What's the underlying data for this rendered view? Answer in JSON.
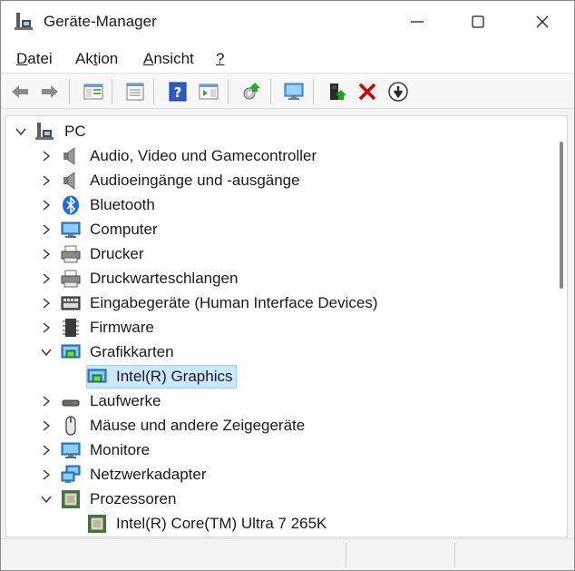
{
  "window": {
    "title": "Geräte-Manager",
    "app_icon": "device-manager-icon"
  },
  "menu": {
    "items": [
      {
        "label": "Datei",
        "underline": "D",
        "rest": "atei"
      },
      {
        "label": "Aktion",
        "underline": "t"
      },
      {
        "label": "Ansicht",
        "underline": "A",
        "rest": "nsicht"
      },
      {
        "label": "?",
        "underline": "?"
      }
    ],
    "datei_pre": "",
    "datei_u": "D",
    "datei_post": "atei",
    "aktion_pre": "Ak",
    "aktion_u": "t",
    "aktion_post": "ion",
    "ansicht_pre": "",
    "ansicht_u": "A",
    "ansicht_post": "nsicht",
    "help_u": "?"
  },
  "toolbar": {
    "icons": [
      "back-arrow-icon",
      "forward-arrow-icon",
      "show-hide-console-tree-icon",
      "properties-icon",
      "help-icon",
      "action-pane-icon",
      "update-driver-icon",
      "scan-hardware-icon",
      "enable-device-icon",
      "uninstall-device-icon",
      "disable-device-icon"
    ]
  },
  "tree": {
    "root": "PC",
    "categories": [
      {
        "label": "Audio, Video und Gamecontroller",
        "icon": "speaker-icon",
        "expanded": false
      },
      {
        "label": "Audioeingänge und -ausgänge",
        "icon": "speaker-icon",
        "expanded": false
      },
      {
        "label": "Bluetooth",
        "icon": "bluetooth-icon",
        "expanded": false
      },
      {
        "label": "Computer",
        "icon": "computer-icon",
        "expanded": false
      },
      {
        "label": "Drucker",
        "icon": "printer-icon",
        "expanded": false
      },
      {
        "label": "Druckwarteschlangen",
        "icon": "printer-icon",
        "expanded": false
      },
      {
        "label": "Eingabegeräte (Human Interface Devices)",
        "icon": "hid-icon",
        "expanded": false
      },
      {
        "label": "Firmware",
        "icon": "chip-icon",
        "expanded": false
      },
      {
        "label": "Grafikkarten",
        "icon": "display-adapter-icon",
        "expanded": true
      },
      {
        "label": "Intel(R) Graphics",
        "icon": "display-adapter-icon",
        "child": true,
        "selected": true
      },
      {
        "label": "Laufwerke",
        "icon": "drive-icon",
        "expanded": false
      },
      {
        "label": "Mäuse und andere Zeigegeräte",
        "icon": "mouse-icon",
        "expanded": false
      },
      {
        "label": "Monitore",
        "icon": "monitor-icon",
        "expanded": false
      },
      {
        "label": "Netzwerkadapter",
        "icon": "network-icon",
        "expanded": false
      },
      {
        "label": "Prozessoren",
        "icon": "processor-icon",
        "expanded": true
      },
      {
        "label": "Intel(R) Core(TM) Ultra 7 265K",
        "icon": "processor-icon",
        "child": true
      }
    ]
  },
  "colors": {
    "selection_bg": "#cce8ff",
    "selection_border": "#99d1ff",
    "uninstall_red": "#d40000",
    "enable_green": "#1aa31a"
  }
}
